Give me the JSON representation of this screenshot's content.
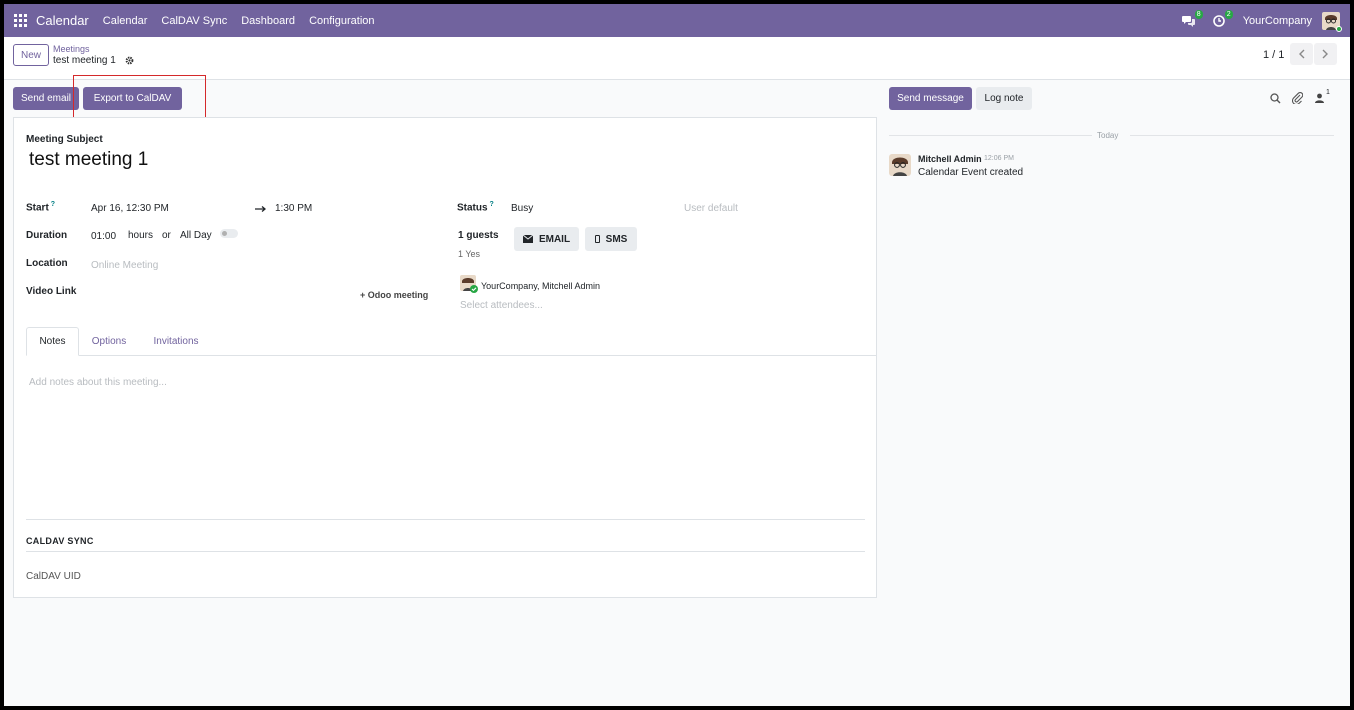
{
  "topnav": {
    "app_name": "Calendar",
    "menu": [
      "Calendar",
      "CalDAV Sync",
      "Dashboard",
      "Configuration"
    ],
    "messages_count": "8",
    "activities_count": "2",
    "company": "YourCompany",
    "accent_color": "#71639e"
  },
  "controlbar": {
    "new_label": "New",
    "breadcrumb": "Meetings",
    "record_title": "test meeting 1",
    "pager": "1 / 1"
  },
  "actions": {
    "send_email": "Send email",
    "export_caldav": "Export to CalDAV"
  },
  "form": {
    "subject_label": "Meeting Subject",
    "subject": "test meeting 1",
    "start_label": "Start",
    "start_value": "Apr 16, 12:30 PM",
    "end_value": "1:30 PM",
    "duration_label": "Duration",
    "duration_value": "01:00",
    "hours_label": "hours",
    "or_label": "or",
    "allday_label": "All Day",
    "location_label": "Location",
    "location_placeholder": "Online Meeting",
    "video_label": "Video Link",
    "odoo_meeting": "Odoo meeting",
    "status_label": "Status",
    "status_value": "Busy",
    "privacy_placeholder": "User default",
    "guests_label": "1 guests",
    "guests_yes": "1 Yes",
    "email_btn": "EMAIL",
    "sms_btn": "SMS",
    "attendee": "YourCompany, Mitchell Admin",
    "attendees_placeholder": "Select attendees..."
  },
  "tabs": [
    "Notes",
    "Options",
    "Invitations"
  ],
  "notes_placeholder": "Add notes about this meeting...",
  "caldav": {
    "section_title": "CALDAV SYNC",
    "uid_label": "CalDAV UID"
  },
  "chatter": {
    "send_message": "Send message",
    "log_note": "Log note",
    "followers_count": "1",
    "date_separator": "Today",
    "message": {
      "author": "Mitchell Admin",
      "time": "12:06 PM",
      "body": "Calendar Event created"
    }
  }
}
